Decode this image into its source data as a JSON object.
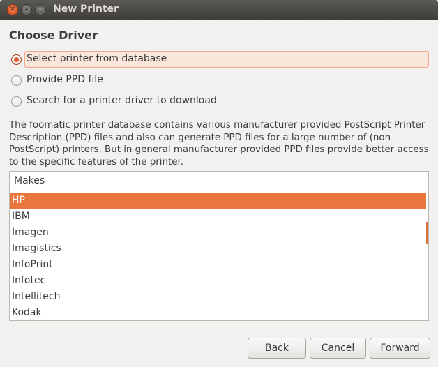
{
  "window": {
    "title": "New Printer",
    "controls": {
      "close_glyph": "✕",
      "minimize_glyph": "–",
      "maximize_glyph": "□"
    }
  },
  "heading": "Choose Driver",
  "options": [
    {
      "label": "Select printer from database",
      "selected": true
    },
    {
      "label": "Provide PPD file",
      "selected": false
    },
    {
      "label": "Search for a printer driver to download",
      "selected": false
    }
  ],
  "description": "The foomatic printer database contains various manufacturer provided PostScript Printer Description (PPD) files and also can generate PPD files for a large number of (non PostScript) printers. But in general manufacturer provided PPD files provide better access to the specific features of the printer.",
  "makes": {
    "header": "Makes",
    "items": [
      "HP",
      "IBM",
      "Imagen",
      "Imagistics",
      "InfoPrint",
      "Infotec",
      "Intellitech",
      "Kodak"
    ],
    "selected": "HP"
  },
  "buttons": {
    "back": "Back",
    "cancel": "Cancel",
    "forward": "Forward"
  },
  "colors": {
    "accent": "#e9763c",
    "selection_highlight": "#fbe6dc",
    "titlebar": "#3e3d39"
  }
}
